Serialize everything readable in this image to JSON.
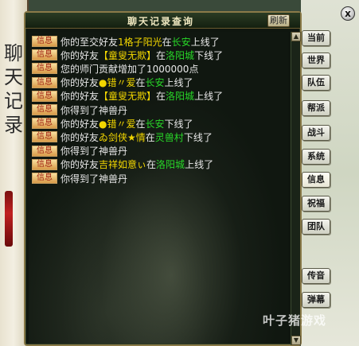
{
  "window": {
    "title": "聊天记录查询",
    "refresh_label": "刷新",
    "close_label": "x"
  },
  "scroll_deco": {
    "text": "聊天记录"
  },
  "messages": [
    {
      "tag": "信息",
      "parts": [
        {
          "t": "你的至交好友",
          "c": "w"
        },
        {
          "t": "1格子阳光",
          "c": "y"
        },
        {
          "t": "在",
          "c": "w"
        },
        {
          "t": "长安",
          "c": "g"
        },
        {
          "t": "上线了",
          "c": "w"
        }
      ]
    },
    {
      "tag": "信息",
      "parts": [
        {
          "t": "你的好友",
          "c": "w"
        },
        {
          "t": "【童叟无欺】",
          "c": "y"
        },
        {
          "t": "在",
          "c": "w"
        },
        {
          "t": "洛阳城",
          "c": "g"
        },
        {
          "t": "下线了",
          "c": "w"
        }
      ]
    },
    {
      "tag": "信息",
      "parts": [
        {
          "t": "您的师门贡献增加了1000000点",
          "c": "w"
        }
      ]
    },
    {
      "tag": "信息",
      "parts": [
        {
          "t": "你的好友",
          "c": "w"
        },
        {
          "t": "●错〃爱",
          "c": "y"
        },
        {
          "t": "在",
          "c": "w"
        },
        {
          "t": "长安",
          "c": "g"
        },
        {
          "t": "上线了",
          "c": "w"
        }
      ]
    },
    {
      "tag": "信息",
      "parts": [
        {
          "t": "你的好友",
          "c": "w"
        },
        {
          "t": "【童叟无欺】",
          "c": "y"
        },
        {
          "t": "在",
          "c": "w"
        },
        {
          "t": "洛阳城",
          "c": "g"
        },
        {
          "t": "上线了",
          "c": "w"
        }
      ]
    },
    {
      "tag": "信息",
      "parts": [
        {
          "t": "你得到了神兽丹",
          "c": "w"
        }
      ]
    },
    {
      "tag": "信息",
      "parts": [
        {
          "t": "你的好友",
          "c": "w"
        },
        {
          "t": "●错〃爱",
          "c": "y"
        },
        {
          "t": "在",
          "c": "w"
        },
        {
          "t": "长安",
          "c": "g"
        },
        {
          "t": "下线了",
          "c": "w"
        }
      ]
    },
    {
      "tag": "信息",
      "parts": [
        {
          "t": "你的好友",
          "c": "w"
        },
        {
          "t": "ゐ剑侠★情",
          "c": "y"
        },
        {
          "t": "在",
          "c": "w"
        },
        {
          "t": "灵兽村",
          "c": "g"
        },
        {
          "t": "下线了",
          "c": "w"
        }
      ]
    },
    {
      "tag": "信息",
      "parts": [
        {
          "t": "你得到了神兽丹",
          "c": "w"
        }
      ]
    },
    {
      "tag": "信息",
      "parts": [
        {
          "t": "你的好友",
          "c": "w"
        },
        {
          "t": "吉祥如意ぃ",
          "c": "y"
        },
        {
          "t": "在",
          "c": "w"
        },
        {
          "t": "洛阳城",
          "c": "g"
        },
        {
          "t": "上线了",
          "c": "w"
        }
      ]
    },
    {
      "tag": "信息",
      "parts": [
        {
          "t": "你得到了神兽丹",
          "c": "w"
        }
      ]
    }
  ],
  "side_buttons": [
    "当前",
    "世界",
    "队伍",
    "帮派",
    "战斗",
    "系统",
    "信息",
    "祝福",
    "团队",
    "传音",
    "弹幕"
  ],
  "active_side_button": "信息",
  "watermark": "叶子猪游戏"
}
